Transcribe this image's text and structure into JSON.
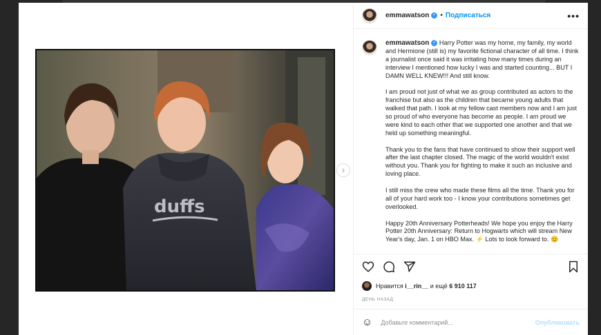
{
  "post": {
    "username": "emmawatson",
    "follow_label": "Подписаться",
    "more_icon": "•••",
    "caption_paragraphs": [
      "Harry Potter was my home, my family, my world and Hermione (still is) my favorite fictional character of all time. I think a journalist once said it was irritating how many times during an interview I mentioned how lucky I was and started counting... BUT I DAMN WELL KNEW!!! And still know.",
      "I am proud not just of what we as group contributed as actors to the franchise but also as the children that became young adults that walked that path. I look at my fellow cast members now and I am just so proud of who everyone has become as people. I am proud we were kind to each other that we supported one another and that we held up something meaningful.",
      "Thank you to the fans that have continued to show their support well after the last chapter closed. The magic of the world wouldn't exist without you. Thank you for fighting to make it such an inclusive and loving place.",
      "I still miss the crew who made these films all the time. Thank you for all of your hard work too - I know your contributions sometimes get overlooked.",
      "Happy 20th Anniversary Potterheads! We hope you enjoy the Harry Potter 20th Anniversary: Return to Hogwarts which will stream New Year's day, Jan. 1 on HBO Max. ⚡ Lots to look forward to. 😊"
    ],
    "likes_prefix": "Нравится",
    "likes_user": "i__rin__",
    "likes_middle": "и ещё",
    "likes_count": "6 910 117",
    "timestamp": "ДЕНЬ НАЗАД",
    "comment_placeholder": "Добавьте комментарий...",
    "publish_label": "Опубликовать",
    "photo_text": "duffs"
  },
  "icons": [
    "heart-icon",
    "comment-icon",
    "share-icon",
    "bookmark-icon",
    "emoji-icon",
    "verified-icon",
    "next-arrow-icon"
  ],
  "colors": {
    "accent": "#0095f6",
    "verified": "#3897f0",
    "publish_disabled": "#b2dffc"
  }
}
